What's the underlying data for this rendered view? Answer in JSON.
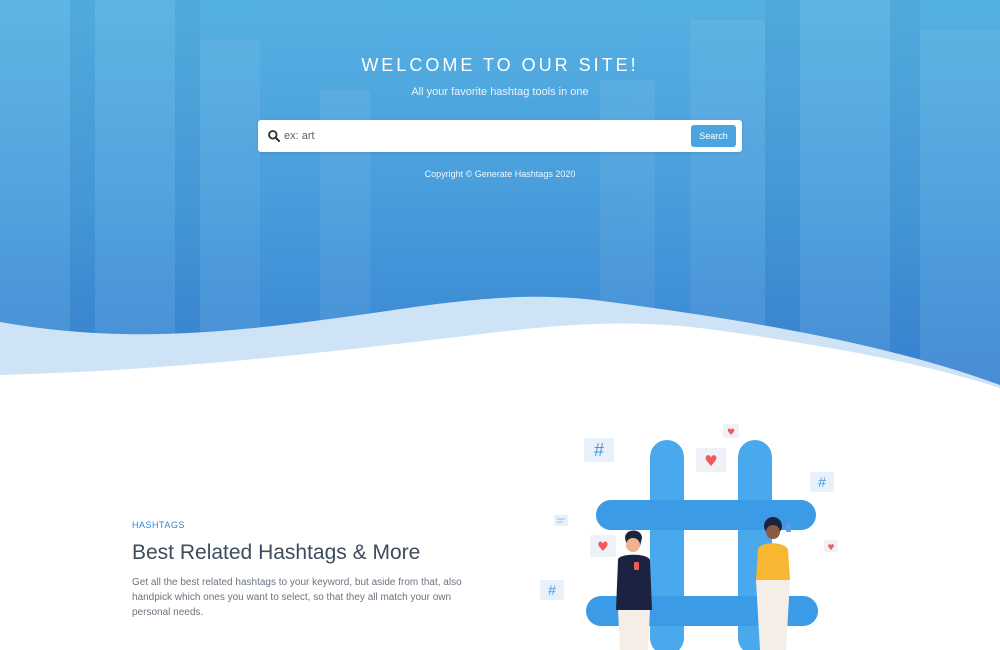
{
  "hero": {
    "title": "WELCOME TO OUR SITE!",
    "subtitle": "All your favorite hashtag tools in one",
    "copyright": "Copyright © Generate Hashtags 2020"
  },
  "search": {
    "placeholder": "ex: art",
    "value": "",
    "button_label": "Search",
    "icon": "search-icon"
  },
  "feature": {
    "label": "HASHTAGS",
    "heading": "Best Related Hashtags & More",
    "description": "Get all the best related hashtags to your keyword, but aside from that, also handpick which ones you want to select, so that they all match your own personal needs."
  },
  "illustration": {
    "icons": [
      "hashtag-icon",
      "heart-icon",
      "chat-icon"
    ]
  },
  "colors": {
    "hero_top": "#55b0e2",
    "hero_bottom": "#3b84d2",
    "accent": "#4aa4e0",
    "label_blue": "#2f86d8",
    "heart_red": "#f05a5a"
  }
}
